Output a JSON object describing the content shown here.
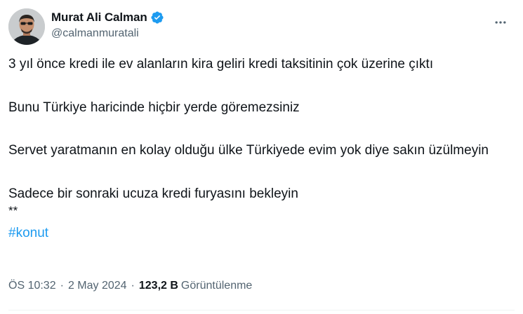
{
  "author": {
    "display_name": "Murat Ali Calman",
    "handle": "@calmanmuratali",
    "verified": true
  },
  "icons": {
    "verified": "verified-badge-icon",
    "more": "more-options-icon"
  },
  "colors": {
    "accent": "#1d9bf0",
    "text": "#0f1419",
    "secondary": "#536471"
  },
  "tweet": {
    "paragraphs": [
      "3 yıl önce kredi ile ev alanların kira geliri kredi taksitinin çok üzerine çıktı",
      "Bunu Türkiye haricinde hiçbir yerde göremezsiniz",
      "Servet yaratmanın en kolay olduğu ülke Türkiyede evim yok diye sakın üzülmeyin",
      "Sadece bir sonraki ucuza kredi furyasını bekleyin",
      "**"
    ],
    "hashtag": "#konut"
  },
  "meta": {
    "time": "ÖS 10:32",
    "date": "2 May 2024",
    "separator": "·",
    "views_count": "123,2 B",
    "views_label": "Görüntülenme"
  }
}
